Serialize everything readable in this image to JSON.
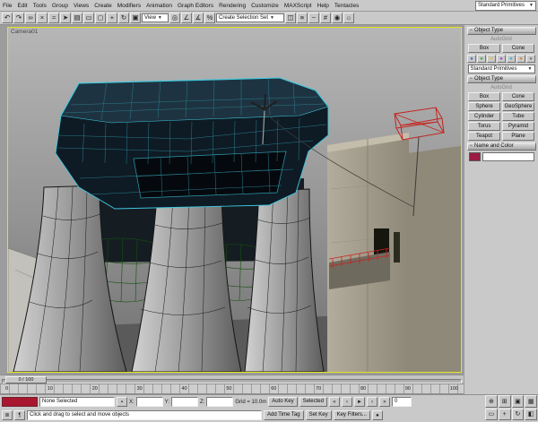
{
  "colors": {
    "viewport_border": "#e4e41c",
    "selection_cyan": "#3fc9df",
    "green_patch": "#33a338",
    "red_accent": "#c5231f",
    "swatch_maroon": "#9b1c45",
    "listener_red": "#a8172f"
  },
  "menu": {
    "items": [
      "File",
      "Edit",
      "Tools",
      "Group",
      "Views",
      "Create",
      "Modifiers",
      "Animation",
      "Graph Editors",
      "Rendering",
      "Customize",
      "MAXScript",
      "Help",
      "Tentacles"
    ]
  },
  "header": {
    "primitives_box": "Standard Primitives"
  },
  "toolbar": {
    "view_dropdown": "View",
    "selection_set": "Create Selection Set",
    "icons": [
      {
        "name": "undo",
        "glyph": "↶"
      },
      {
        "name": "redo",
        "glyph": "↷"
      },
      {
        "name": "select-and-link",
        "glyph": "∞"
      },
      {
        "name": "unlink",
        "glyph": "×"
      },
      {
        "name": "bind-to-space-warp",
        "glyph": "≈"
      },
      {
        "name": "select-object",
        "glyph": "➤"
      },
      {
        "name": "select-by-name",
        "glyph": "▤"
      },
      {
        "name": "rectangular-selection",
        "glyph": "▭"
      },
      {
        "name": "window-crossing",
        "glyph": "◻"
      },
      {
        "name": "select-and-move",
        "glyph": "+"
      },
      {
        "name": "select-and-rotate",
        "glyph": "↻"
      },
      {
        "name": "select-and-scale",
        "glyph": "▣"
      },
      {
        "name": "use-pivot-center",
        "glyph": "◎"
      },
      {
        "name": "snap-toggle",
        "glyph": "∠"
      },
      {
        "name": "angle-snap",
        "glyph": "∡"
      },
      {
        "name": "percent-snap",
        "glyph": "%"
      },
      {
        "name": "mirror",
        "glyph": "◫"
      },
      {
        "name": "align",
        "glyph": "≡"
      },
      {
        "name": "curve-editor",
        "glyph": "~"
      },
      {
        "name": "schematic-view",
        "glyph": "#"
      },
      {
        "name": "material-editor",
        "glyph": "◉"
      },
      {
        "name": "render-scene",
        "glyph": "☼"
      }
    ]
  },
  "viewport": {
    "label": "Camera01"
  },
  "panel": {
    "mini": {
      "header": "Object Type",
      "autogrid": "AutoGrid",
      "buttons": [
        "Box",
        "Cone"
      ]
    },
    "category_icons": [
      {
        "name": "geometry",
        "glyph": "●"
      },
      {
        "name": "shapes",
        "glyph": "●"
      },
      {
        "name": "lights",
        "glyph": "●"
      },
      {
        "name": "cameras",
        "glyph": "●"
      },
      {
        "name": "helpers",
        "glyph": "●"
      },
      {
        "name": "space-warps",
        "glyph": "●"
      },
      {
        "name": "systems",
        "glyph": "●"
      }
    ],
    "dropdown": "Standard Primitives",
    "object_type": {
      "header": "Object Type",
      "autogrid": "AutoGrid",
      "buttons": [
        "Box",
        "Cone",
        "Sphere",
        "GeoSphere",
        "Cylinder",
        "Tube",
        "Torus",
        "Pyramid",
        "Teapot",
        "Plane"
      ]
    },
    "name_color": {
      "header": "Name and Color"
    }
  },
  "timeline": {
    "handle": "0 / 100"
  },
  "trackbar": {
    "ticks": [
      "0",
      "10",
      "20",
      "30",
      "40",
      "50",
      "60",
      "70",
      "80",
      "90",
      "100"
    ]
  },
  "statusbar": {
    "selection": "None Selected",
    "prompt": "Click and drag to select and move objects",
    "grid": "Grid = 10.0m",
    "add_time_tag": "Add Time Tag",
    "x_label": "X:",
    "y_label": "Y:",
    "z_label": "Z:",
    "x_value": "",
    "y_value": "",
    "z_value": "",
    "auto_key": "Auto Key",
    "set_key": "Set Key",
    "selected": "Selected",
    "key_filters": "Key Filters...",
    "time_value": "0"
  },
  "transport": {
    "icons": [
      {
        "name": "go-to-start",
        "glyph": "«"
      },
      {
        "name": "previous-frame",
        "glyph": "‹"
      },
      {
        "name": "play",
        "glyph": "►"
      },
      {
        "name": "next-frame",
        "glyph": "›"
      },
      {
        "name": "go-to-end",
        "glyph": "»"
      }
    ]
  },
  "nav": {
    "icons": [
      {
        "name": "zoom",
        "glyph": "⊕"
      },
      {
        "name": "zoom-all",
        "glyph": "⊞"
      },
      {
        "name": "zoom-extents",
        "glyph": "▣"
      },
      {
        "name": "zoom-extents-all",
        "glyph": "▦"
      },
      {
        "name": "zoom-region",
        "glyph": "▭"
      },
      {
        "name": "pan",
        "glyph": "+"
      },
      {
        "name": "arc-rotate",
        "glyph": "↻"
      },
      {
        "name": "min-max-toggle",
        "glyph": "◧"
      }
    ]
  }
}
